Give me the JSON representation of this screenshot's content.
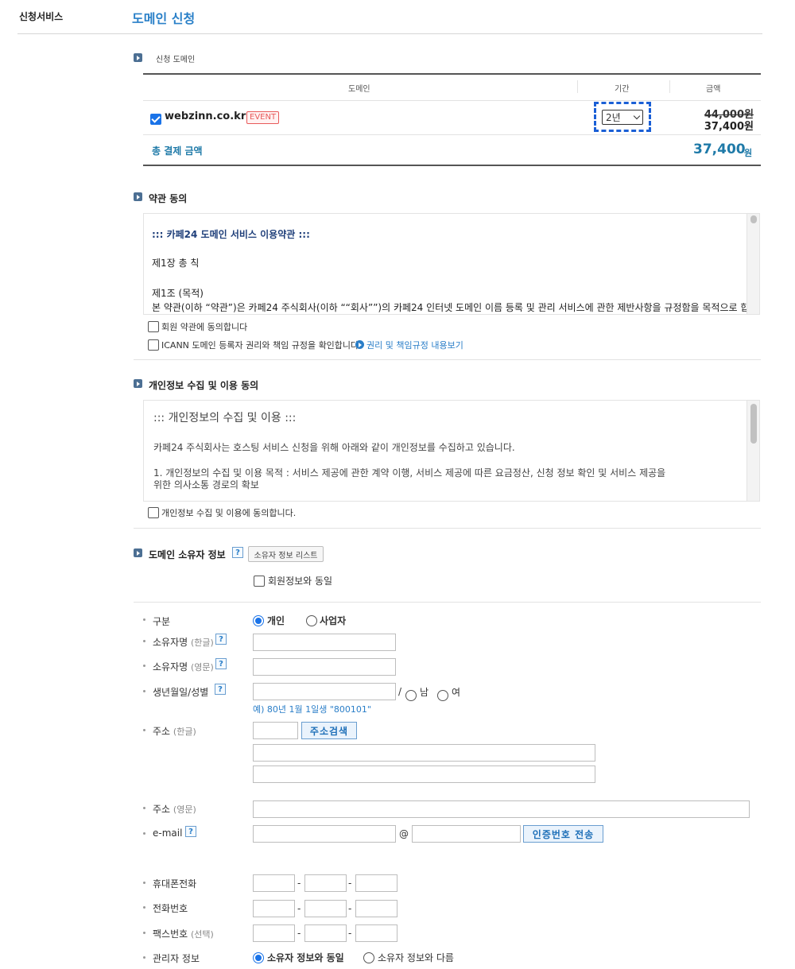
{
  "side_title": "신청서비스",
  "page_title": "도메인 신청",
  "apply_domain": {
    "section_label": "신청 도메인",
    "headers": {
      "domain": "도메인",
      "period": "기간",
      "amount": "금액"
    },
    "row": {
      "domain": "webzinn.co.kr",
      "badge": "EVENT",
      "period": "2년",
      "original_price": "44,000원",
      "price": "37,400원",
      "checked": true
    },
    "total_label": "총 결제 금액",
    "total_value": "37,400",
    "total_unit": "원"
  },
  "terms": {
    "section_label": "약관 동의",
    "content_title": "::: 카페24 도메인 서비스 이용약관 :::",
    "chapter": "제1장 총 칙",
    "article": "제1조 (목적)",
    "article_text": "본 약관(이하 “약관”)은 카페24 주식회사(이하 ““회사””)의 카페24 인터넷 도메인 이름 등록 및 관리 서비스에 관한 제반사항을 규정함을 목적으로 합",
    "agree_member": "회원 약관에 동의합니다",
    "agree_icann": "ICANN 도메인 등록자 권리와 책임 규정을 확인합니다.",
    "icann_link": "권리 및 책임규정 내용보기"
  },
  "privacy": {
    "section_label": "개인정보 수집 및 이용 동의",
    "content_title": "::: 개인정보의 수집 및 이용 :::",
    "line1": "카페24 주식회사는 호스팅 서비스 신청을 위해 아래와 같이 개인정보를 수집하고 있습니다.",
    "line2": "1. 개인정보의 수집 및 이용 목적 : 서비스 제공에 관한 계약 이행, 서비스 제공에 따른 요금정산, 신청 정보 확인 및 서비스 제공을",
    "line3": "위한 의사소통 경로의 확보",
    "agree": "개인정보 수집 및 이용에 동의합니다."
  },
  "owner": {
    "section_label": "도메인 소유자 정보",
    "help": "?",
    "list_button": "소유자 정보 리스트",
    "same_as_member": "회원정보와 동일",
    "fields": {
      "type_label": "구분",
      "type_personal": "개인",
      "type_business": "사업자",
      "name_kr_label": "소유자명",
      "name_kr_sub": "(한글)",
      "name_en_label": "소유자명",
      "name_en_sub": "(영문)",
      "birth_label": "생년월일/성별",
      "slash": "/",
      "male": "남",
      "female": "여",
      "birth_hint": "예) 80년 1월 1일생 \"800101\"",
      "addr_kr_label": "주소",
      "addr_kr_sub": "(한글)",
      "addr_search": "주소검색",
      "addr_en_label": "주소",
      "addr_en_sub": "(영문)",
      "email_label": "e-mail",
      "at": "@",
      "send_code": "인증번호 전송",
      "mobile_label": "휴대폰전화",
      "phone_label": "전화번호",
      "fax_label": "팩스번호",
      "fax_sub": "(선택)",
      "dash": "-",
      "admin_label": "관리자 정보",
      "admin_same": "소유자 정보와 동일",
      "admin_diff": "소유자 정보와 다름"
    }
  },
  "colors": {
    "accent": "#2a80c8",
    "total": "#1f7aa8",
    "dashed_focus": "#1a5fd6",
    "event": "#e85a5a"
  }
}
